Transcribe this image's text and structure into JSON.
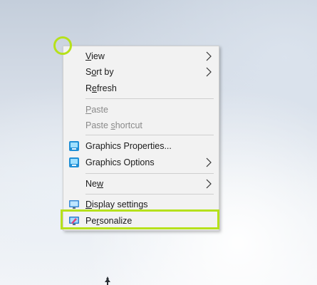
{
  "menu": {
    "items": [
      {
        "pre": "",
        "ul": "V",
        "post": "iew"
      },
      {
        "pre": "S",
        "ul": "o",
        "post": "rt by"
      },
      {
        "pre": "R",
        "ul": "e",
        "post": "fresh"
      },
      {
        "pre": "",
        "ul": "P",
        "post": "aste"
      },
      {
        "pre": "Paste ",
        "ul": "s",
        "post": "hortcut"
      },
      {
        "pre": "Graphics Properties...",
        "ul": "",
        "post": ""
      },
      {
        "pre": "Graphics Options",
        "ul": "",
        "post": ""
      },
      {
        "pre": "Ne",
        "ul": "w",
        "post": ""
      },
      {
        "pre": "",
        "ul": "D",
        "post": "isplay settings"
      },
      {
        "pre": "Pe",
        "ul": "r",
        "post": "sonalize"
      }
    ]
  },
  "colors": {
    "highlight": "#b6e11b",
    "menu_bg": "#f2f2f2",
    "disabled_text": "#8a8a8a"
  },
  "icons": {
    "submenu": "chevron-right-icon",
    "graphics": "intel-graphics-icon",
    "display": "display-icon",
    "personalize": "personalize-icon"
  }
}
